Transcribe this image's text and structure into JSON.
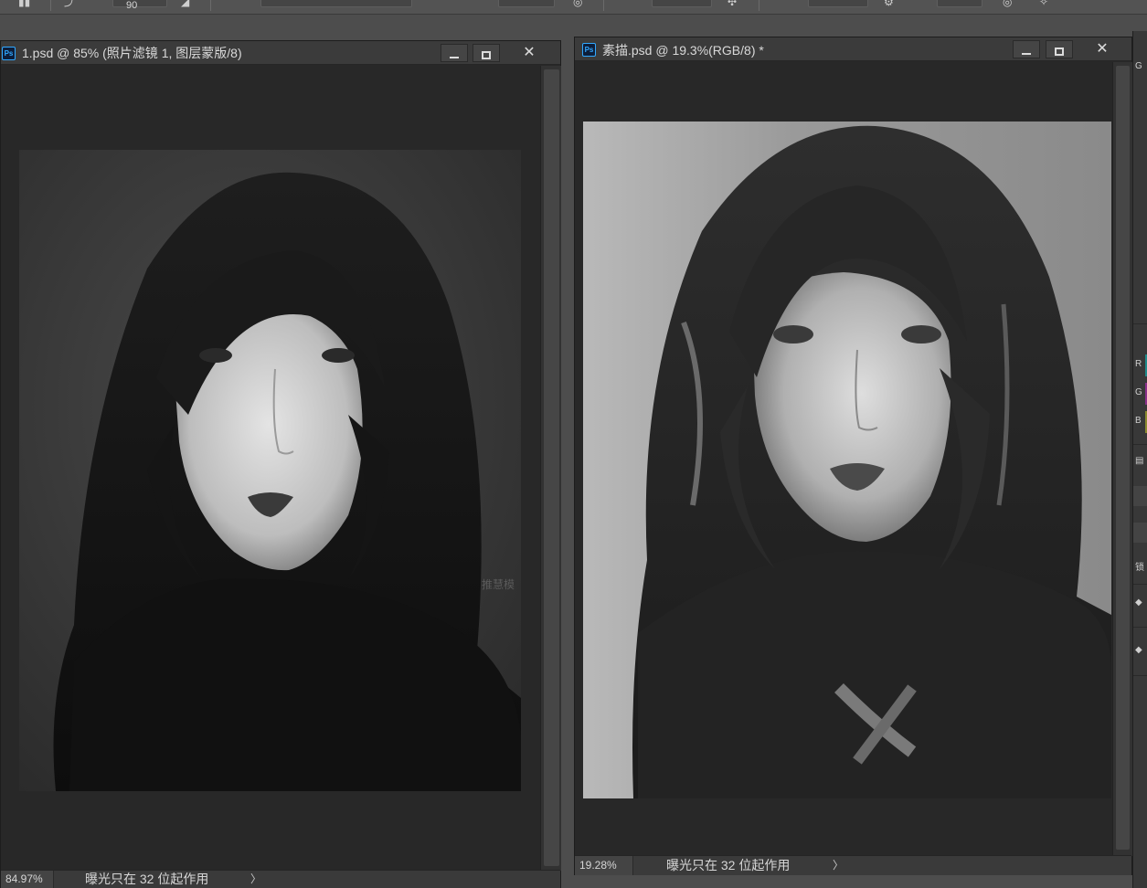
{
  "top_options_bar": {
    "angle_value": "90"
  },
  "windows": [
    {
      "title": "1.psd @ 85% (照片滤镜 1, 图层蒙版/8)",
      "zoom": "84.97%",
      "status_message": "曝光只在 32 位起作用",
      "status_arrow": "〉",
      "photo_watermark": "推慧模"
    },
    {
      "title": "素描.psd @ 19.3%(RGB/8) *",
      "zoom": "19.28%",
      "status_message": "曝光只在 32 位起作用",
      "status_arrow": "〉"
    }
  ],
  "right_panel": {
    "channels": [
      {
        "label": "R",
        "color": "#1f8a8a"
      },
      {
        "label": "G",
        "color": "#8a2f8a"
      },
      {
        "label": "B",
        "color": "#8a8a2f"
      }
    ],
    "partial_label": "锁"
  },
  "colors": {
    "ps_blue": "#31a8ff",
    "window_bg": "#282828",
    "titlebar_bg": "#3b3b3b",
    "workspace_bg": "#4d4d4d"
  }
}
